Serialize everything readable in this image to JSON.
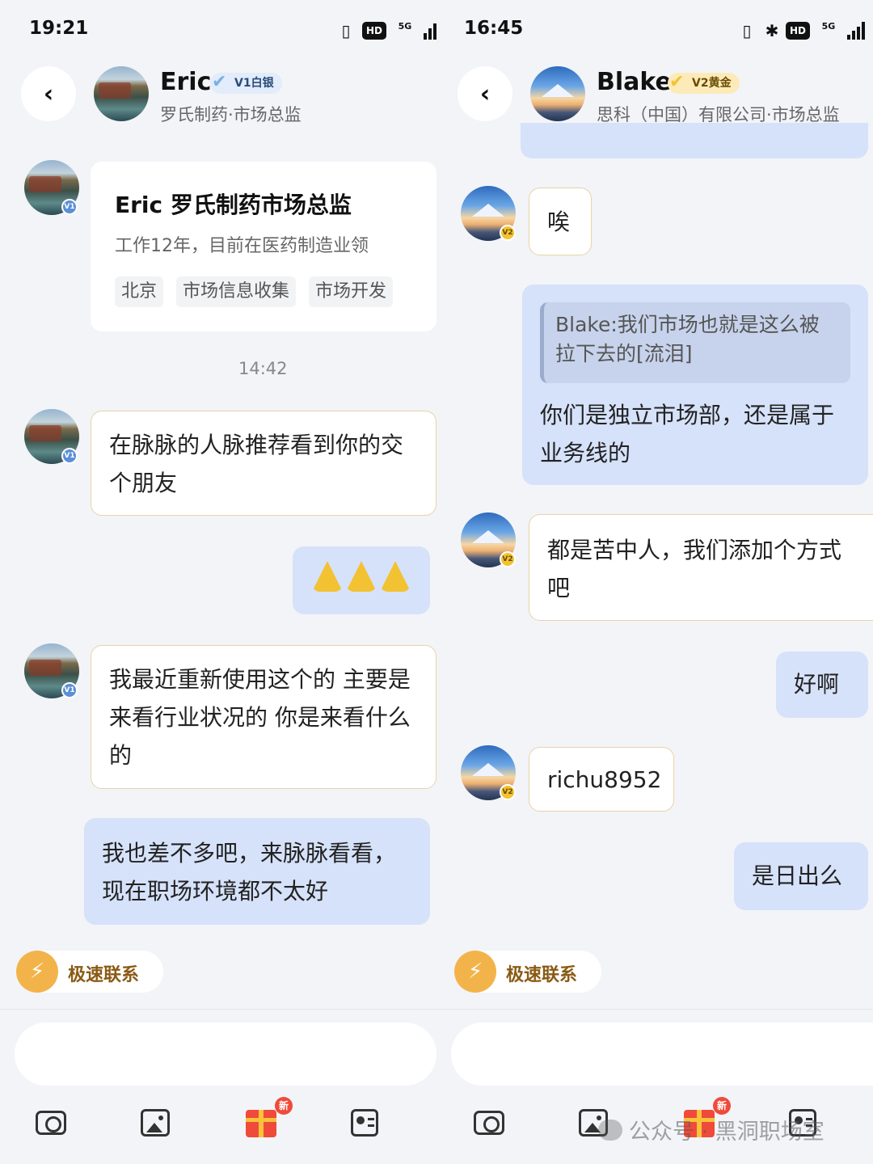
{
  "left": {
    "status": {
      "time": "19:21",
      "network": "5G"
    },
    "header": {
      "name": "Eric",
      "badge": "V1白银",
      "subtitle": "罗氏制药·市场总监"
    },
    "avatar_badge": "V1",
    "card": {
      "title": "Eric 罗氏制药市场总监",
      "desc": "工作12年，目前在医药制造业领",
      "tags": [
        "北京",
        "市场信息收集",
        "市场开发"
      ]
    },
    "timestamp": "14:42",
    "messages": [
      {
        "from": "them",
        "text": "在脉脉的人脉推荐看到你的交个朋友"
      },
      {
        "from": "me",
        "emoji": "🙏🙏🙏"
      },
      {
        "from": "them",
        "text": "我最近重新使用这个的 主要是来看行业状况的 你是来看什么的"
      },
      {
        "from": "me",
        "text": "我也差不多吧，来脉脉看看，现在职场环境都不太好"
      }
    ],
    "quick_contact": "极速联系",
    "toolbar": {
      "new_badge": "新"
    }
  },
  "right": {
    "status": {
      "time": "16:45",
      "network": "5G"
    },
    "header": {
      "name": "Blake",
      "badge": "V2黄金",
      "subtitle": "思科（中国）有限公司·市场总监"
    },
    "avatar_badge": "V2",
    "messages": [
      {
        "from": "them",
        "text": "唉"
      },
      {
        "from": "me",
        "quote": "Blake:我们市场也就是这么被拉下去的[流泪]",
        "text": "你们是独立市场部，还是属于业务线的"
      },
      {
        "from": "them",
        "text": "都是苦中人，我们添加个方式吧"
      },
      {
        "from": "me",
        "text": "好啊"
      },
      {
        "from": "them",
        "text": "richu8952"
      },
      {
        "from": "me",
        "text": "是日出么"
      }
    ],
    "quick_contact": "极速联系",
    "toolbar": {
      "new_badge": "新"
    }
  },
  "watermark": "公众号 · 黑洞职场室",
  "colors": {
    "background": "#f2f4f8",
    "incoming_bubble": "#ffffff",
    "incoming_border": "#ead2a8",
    "outgoing_bubble": "#d6e2fa",
    "quick_contact_accent": "#f2b44a",
    "gift_red": "#f04a3a"
  },
  "icons": [
    "back-arrow-icon",
    "vibrate-icon",
    "bluetooth-icon",
    "hd-icon",
    "signal-icon",
    "lightning-icon",
    "camera-icon",
    "image-icon",
    "gift-icon",
    "contact-card-icon"
  ]
}
